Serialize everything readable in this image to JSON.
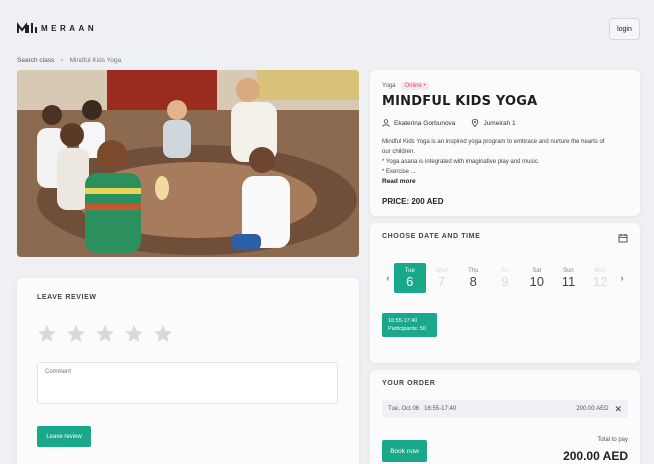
{
  "brand": {
    "name": "MERAAN"
  },
  "header": {
    "login_label": "login"
  },
  "breadcrumb": {
    "parent": "Search class",
    "separator": "»",
    "current": "Mindful Kids Yoga"
  },
  "class": {
    "category": "Yoga",
    "status": "Online •",
    "title": "MINDFUL KIDS YOGA",
    "instructor": "Ekaterina Gorbunova",
    "location": "Jumeirah 1",
    "description_lines": [
      "Mindful Kids Yoga is an inspired yoga program to embrace and nurture the hearts of",
      "our children.",
      "* Yoga asana is integrated with imaginative play and music.",
      "* Exercise ..."
    ],
    "read_more": "Read more",
    "price": "PRICE: 200 AED"
  },
  "schedule": {
    "title": "CHOOSE DATE AND TIME",
    "prev": "‹",
    "next": "›",
    "days": [
      {
        "name": "Tue",
        "num": "6",
        "state": "active"
      },
      {
        "name": "Wed",
        "num": "7",
        "state": "faded"
      },
      {
        "name": "Thu",
        "num": "8",
        "state": "normal"
      },
      {
        "name": "Fri",
        "num": "9",
        "state": "faded"
      },
      {
        "name": "Sat",
        "num": "10",
        "state": "normal"
      },
      {
        "name": "Sun",
        "num": "11",
        "state": "normal"
      },
      {
        "name": "Mon",
        "num": "12",
        "state": "faded"
      }
    ],
    "slot": {
      "time": "16:55-17:40",
      "participants": "Participants: 50"
    }
  },
  "order": {
    "title": "YOUR ORDER",
    "item_date": "Tue, Oct 06",
    "item_time": "16:55-17:40",
    "item_price": "200.00 AED",
    "remove": "✕",
    "book_label": "Book now",
    "total_label": "Total to pay",
    "total_value": "200.00 AED"
  },
  "review": {
    "title": "LEAVE REVIEW",
    "rating": 0,
    "max_rating": 5,
    "comment_placeholder": "Comment",
    "submit_label": "Leave review"
  },
  "colors": {
    "accent": "#1aa88a",
    "online": "#e0457b",
    "background": "#eef0f4"
  }
}
